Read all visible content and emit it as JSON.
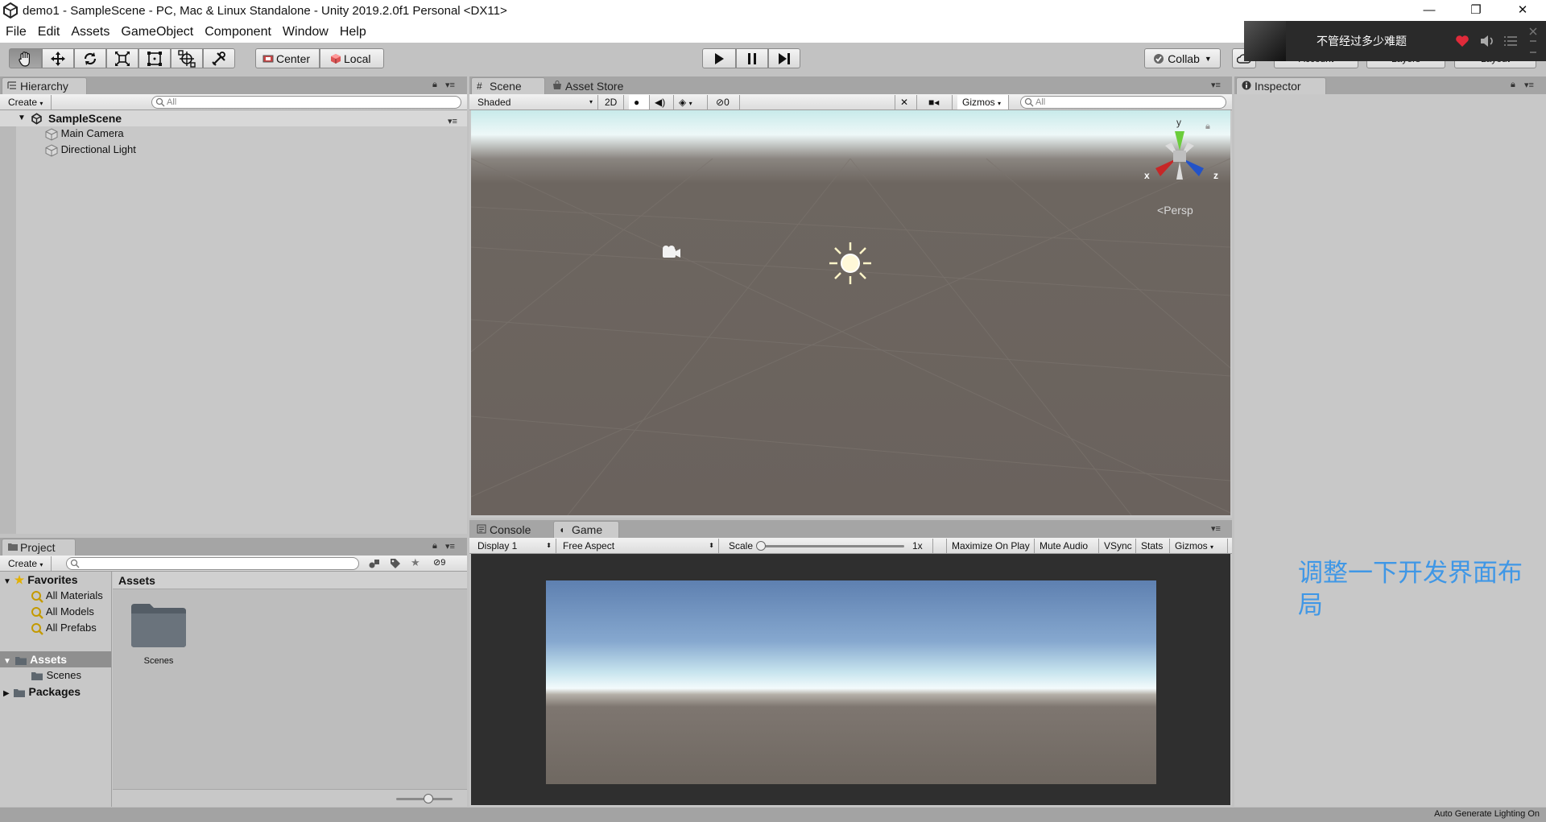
{
  "window": {
    "title": "demo1 - SampleScene - PC, Mac & Linux Standalone - Unity 2019.2.0f1 Personal <DX11>",
    "controls": {
      "minimize": "—",
      "maximize": "❐",
      "close": "✕"
    }
  },
  "menu": [
    "File",
    "Edit",
    "Assets",
    "GameObject",
    "Component",
    "Window",
    "Help"
  ],
  "toolbar": {
    "pivot_label": "Center",
    "space_label": "Local",
    "collab_label": "Collab",
    "account_label": "Account",
    "layers_label": "Layers",
    "layout_label": "Layout"
  },
  "notification": {
    "text": "不管经过多少难题"
  },
  "hierarchy": {
    "tab": "Hierarchy",
    "create": "Create",
    "search_placeholder": "All",
    "scene": "SampleScene",
    "items": [
      "Main Camera",
      "Directional Light"
    ]
  },
  "scene": {
    "tab": "Scene",
    "asset_store_tab": "Asset Store",
    "shading": "Shaded",
    "mode_2d": "2D",
    "hidden_count": "0",
    "gizmos": "Gizmos",
    "search_placeholder": "All",
    "persp": "Persp",
    "axes": {
      "x": "x",
      "y": "y",
      "z": "z"
    }
  },
  "game": {
    "console_tab": "Console",
    "game_tab": "Game",
    "display": "Display 1",
    "aspect": "Free Aspect",
    "scale_label": "Scale",
    "scale_value": "1x",
    "maximize": "Maximize On Play",
    "mute": "Mute Audio",
    "vsync": "VSync",
    "stats": "Stats",
    "gizmos": "Gizmos"
  },
  "project": {
    "tab": "Project",
    "create": "Create",
    "hidden_count": "9",
    "favorites": "Favorites",
    "fav_items": [
      "All Materials",
      "All Models",
      "All Prefabs"
    ],
    "assets": "Assets",
    "scenes": "Scenes",
    "packages": "Packages",
    "breadcrumb": "Assets",
    "folder_label": "Scenes"
  },
  "inspector": {
    "tab": "Inspector",
    "note": "调整一下开发界面布局"
  },
  "status": {
    "text": "Auto Generate Lighting On"
  }
}
